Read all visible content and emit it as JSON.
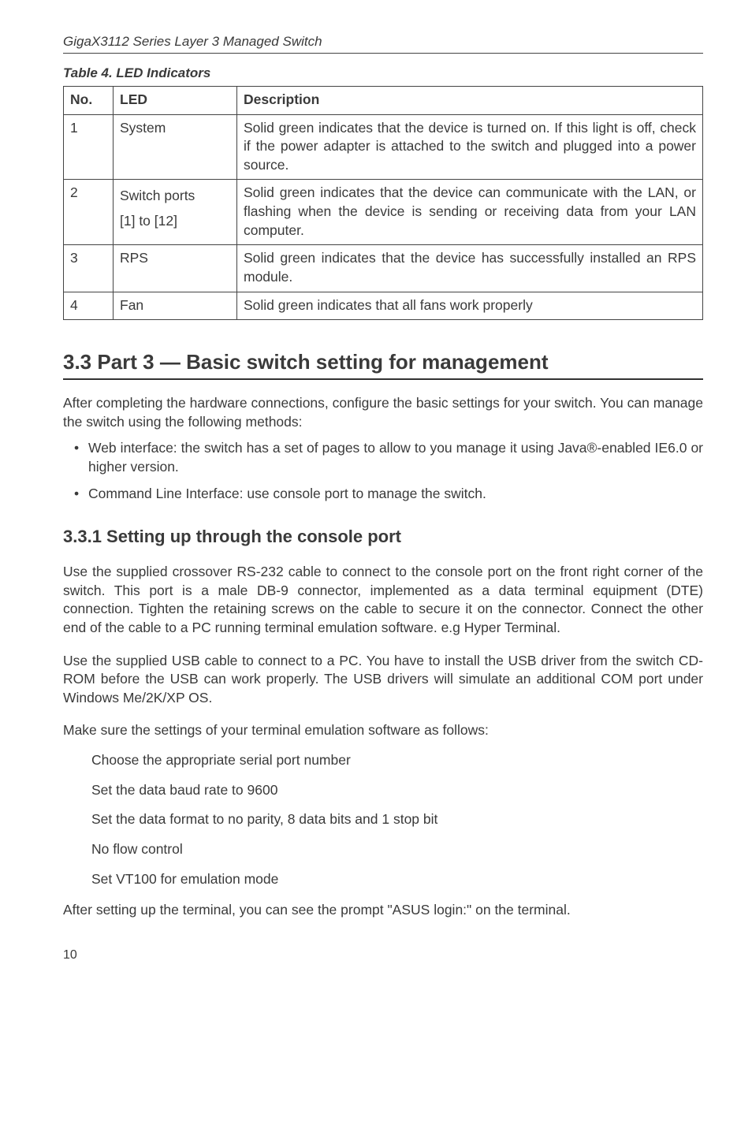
{
  "header": "GigaX3112 Series Layer 3 Managed Switch",
  "table": {
    "caption": "Table 4.  LED Indicators",
    "headers": {
      "no": "No.",
      "led": "LED",
      "desc": "Description"
    },
    "rows": [
      {
        "no": "1",
        "led": "System",
        "desc": "Solid green indicates that the device is turned on. If this light is off, check if the power adapter is attached to the switch and plugged into a power source."
      },
      {
        "no": "2",
        "led_a": "Switch ports",
        "led_b": "[1] to [12]",
        "desc": "Solid green indicates that the device can communicate with the LAN, or flashing when the device is sending or receiving data from your LAN computer."
      },
      {
        "no": "3",
        "led": "RPS",
        "desc": "Solid green indicates that the device has successfully installed an RPS module."
      },
      {
        "no": "4",
        "led": "Fan",
        "desc": "Solid green indicates that all fans work properly"
      }
    ]
  },
  "section": {
    "title": "3.3 Part 3 — Basic switch setting for management",
    "intro": "After completing the hardware connections, configure the basic settings for your switch. You can manage the switch using the following methods:",
    "bullets": [
      "Web interface: the switch has a set of pages to allow to you manage it using Java®-enabled IE6.0 or higher version.",
      "Command Line Interface: use console port to manage the switch."
    ]
  },
  "subsection": {
    "title": "3.3.1    Setting up through the console port",
    "p1": "Use the supplied crossover RS-232 cable to connect to the console port on the front right corner of the switch. This port is a male DB-9 connector, implemented as a data terminal equipment (DTE) connection. Tighten the retaining screws on the cable to secure it on the connector. Connect the other end of the cable to a PC running terminal emulation software. e.g Hyper Terminal.",
    "p2": "Use the supplied USB cable to connect to a PC. You have to install the USB driver from the switch CD-ROM before the USB can work properly. The USB drivers will simulate an additional COM port under Windows Me/2K/XP OS.",
    "p3": "Make sure the settings of your terminal emulation software as follows:",
    "steps": [
      "Choose the appropriate serial port number",
      "Set the data baud rate to 9600",
      "Set the data format to no parity, 8 data bits and 1 stop bit",
      "No flow control",
      "Set VT100 for emulation mode"
    ],
    "p4": "After setting up the terminal, you can see the prompt \"ASUS login:\" on the terminal."
  },
  "page_number": "10"
}
